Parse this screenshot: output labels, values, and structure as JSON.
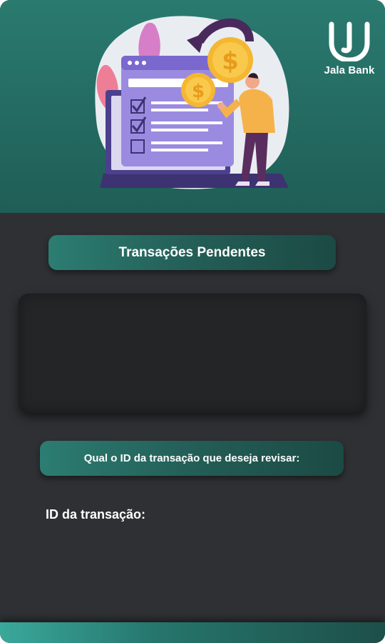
{
  "header": {
    "brand_name": "Jala Bank",
    "logo_icon": "jala-bank-logo-icon",
    "illustration": "payment-checklist-laptop-illustration"
  },
  "main": {
    "title": "Transações Pendentes",
    "transactions_list": [],
    "question": "Qual o ID da transação que deseja revisar:",
    "input_label": "ID da transação:",
    "input_value": ""
  },
  "colors": {
    "header_gradient_top": "#2a7a70",
    "header_gradient_bottom": "#1f5e56",
    "page_background": "#2f3033",
    "panel_background": "#242527",
    "accent_teal": "#2c7d72",
    "footer_teal": "#3aa89b",
    "text": "#ffffff"
  }
}
